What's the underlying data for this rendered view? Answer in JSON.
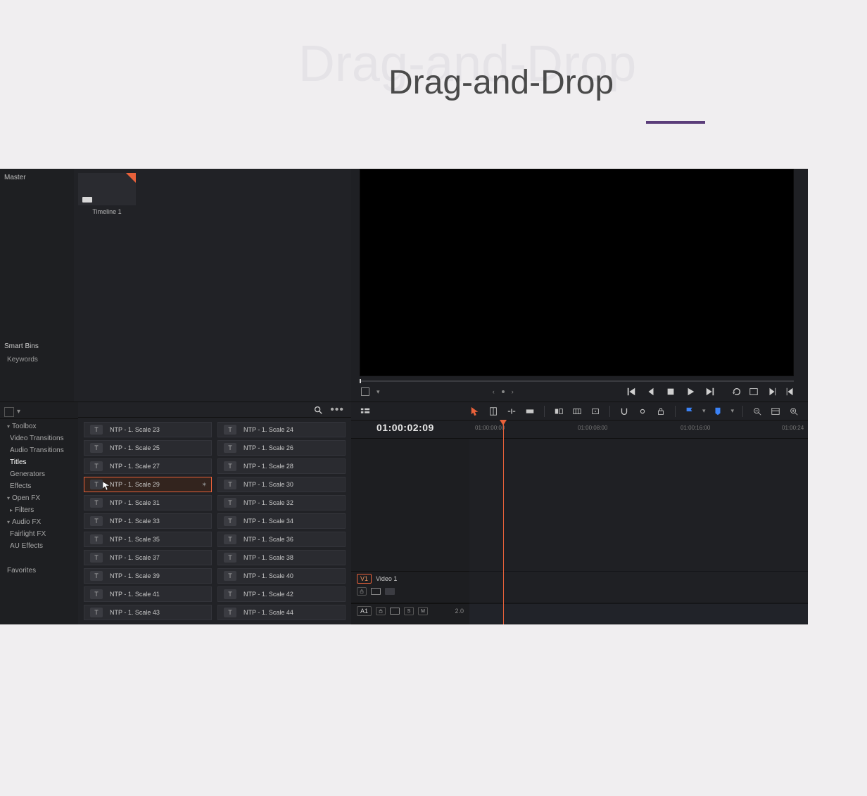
{
  "page": {
    "title_ghost": "Drag-and-Drop",
    "title_main": "Drag-and-Drop"
  },
  "media": {
    "top_label": "Master",
    "clip_label": "Timeline 1",
    "smart_bins_header": "Smart Bins",
    "smart_bin_item": "Keywords"
  },
  "toolbox": {
    "header": "Toolbox",
    "items": {
      "video_transitions": "Video Transitions",
      "audio_transitions": "Audio Transitions",
      "titles": "Titles",
      "generators": "Generators",
      "effects": "Effects"
    },
    "openfx": {
      "header": "Open FX",
      "filters": "Filters"
    },
    "audiofx": {
      "header": "Audio FX",
      "fairlight": "Fairlight FX",
      "au": "AU Effects"
    },
    "favorites": "Favorites"
  },
  "titles_list": {
    "label_23": "NTP - 1. Scale 23",
    "label_24": "NTP - 1. Scale 24",
    "label_25": "NTP - 1. Scale 25",
    "label_26": "NTP - 1. Scale 26",
    "label_27": "NTP - 1. Scale 27",
    "label_28": "NTP - 1. Scale 28",
    "label_29": "NTP - 1. Scale 29",
    "label_30": "NTP - 1. Scale 30",
    "label_31": "NTP - 1. Scale 31",
    "label_32": "NTP - 1. Scale 32",
    "label_33": "NTP - 1. Scale 33",
    "label_34": "NTP - 1. Scale 34",
    "label_35": "NTP - 1. Scale 35",
    "label_36": "NTP - 1. Scale 36",
    "label_37": "NTP - 1. Scale 37",
    "label_38": "NTP - 1. Scale 38",
    "label_39": "NTP - 1. Scale 39",
    "label_40": "NTP - 1. Scale 40",
    "label_41": "NTP - 1. Scale 41",
    "label_42": "NTP - 1. Scale 42",
    "label_43": "NTP - 1. Scale 43",
    "label_44": "NTP - 1. Scale 44",
    "selected": "label_29"
  },
  "timeline": {
    "timecode": "01:00:02:09",
    "ticks": {
      "t0": "01:00:00:00",
      "t1": "01:00:08:00",
      "t2": "01:00:16:00",
      "t3": "01:00:24"
    },
    "tracks": {
      "v1_badge": "V1",
      "v1_name": "Video 1",
      "a1_badge": "A1",
      "a1_lane": "2.0",
      "a1_s": "S",
      "a1_m": "M"
    }
  },
  "icons": {
    "t_glyph": "T"
  }
}
